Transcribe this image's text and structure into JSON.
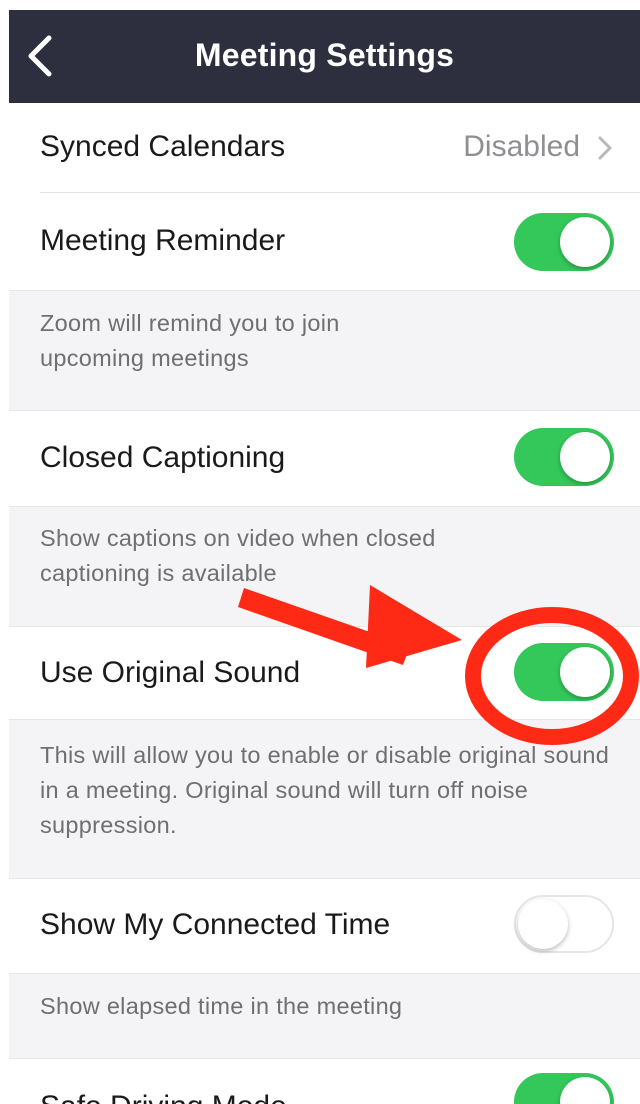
{
  "navbar": {
    "title": "Meeting Settings",
    "background_color": "#2d2e3e",
    "back_icon": "chevron-left-icon"
  },
  "settings": {
    "synced_calendars": {
      "label": "Synced Calendars",
      "value": "Disabled"
    },
    "meeting_reminder": {
      "label": "Meeting Reminder",
      "enabled": true,
      "description": "Zoom will remind you to join upcoming meetings"
    },
    "closed_captioning": {
      "label": "Closed Captioning",
      "enabled": true,
      "description": "Show captions on video when closed captioning is available"
    },
    "original_sound": {
      "label": "Use Original Sound",
      "enabled": true,
      "description": "This will allow you to enable or disable original sound in a meeting. Original sound will turn off noise suppression."
    },
    "connected_time": {
      "label": "Show My Connected Time",
      "enabled": false,
      "description": "Show elapsed time in the meeting"
    },
    "safe_driving": {
      "label": "Safe Driving Mode",
      "enabled": true
    }
  },
  "colors": {
    "toggle_on": "#34c759",
    "annotation": "#ff2a16"
  },
  "annotation": {
    "arrow_icon": "red-arrow-icon",
    "circle_icon": "red-circle-highlight-icon"
  }
}
